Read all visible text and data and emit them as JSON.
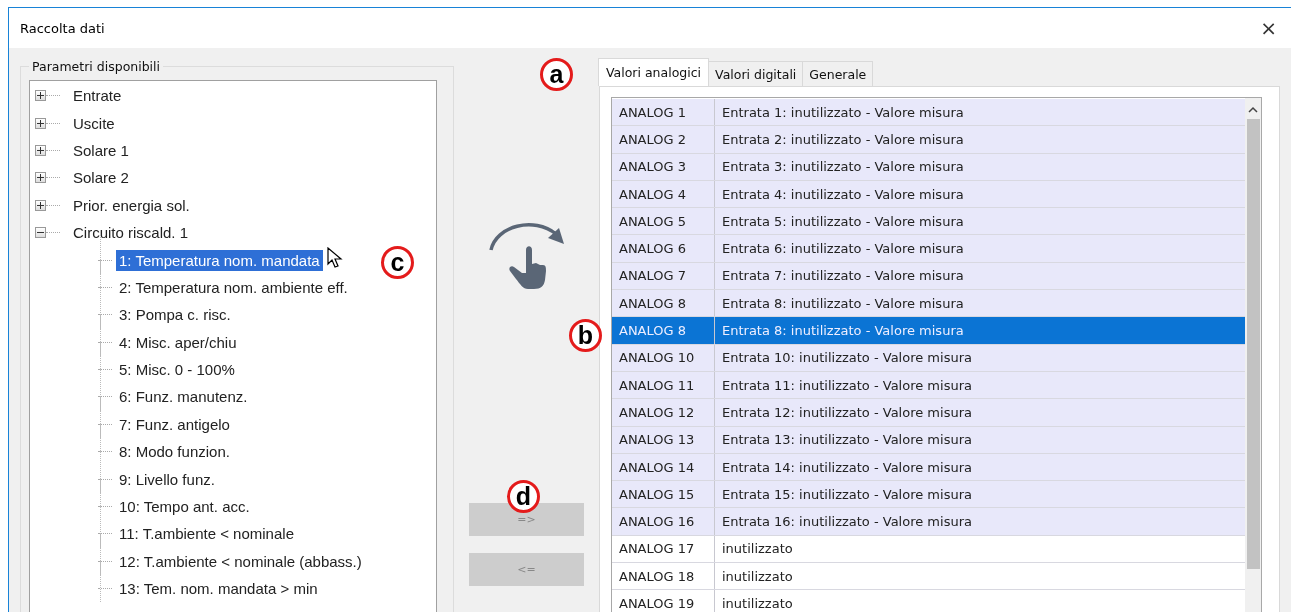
{
  "window": {
    "title": "Raccolta dati",
    "close": "×"
  },
  "parameters": {
    "title": "Parametri disponibili",
    "tree": [
      {
        "label": "Entrate",
        "expanded": false
      },
      {
        "label": "Uscite",
        "expanded": false
      },
      {
        "label": "Solare 1",
        "expanded": false
      },
      {
        "label": "Solare 2",
        "expanded": false
      },
      {
        "label": "Prior. energia sol.",
        "expanded": false
      },
      {
        "label": "Circuito riscald. 1",
        "expanded": true,
        "children": [
          {
            "label": "1: Temperatura nom. mandata",
            "selected": true
          },
          {
            "label": "2: Temperatura nom. ambiente eff.",
            "selected": false
          },
          {
            "label": "3: Pompa c. risc.",
            "selected": false
          },
          {
            "label": "4: Misc. aper/chiu",
            "selected": false
          },
          {
            "label": "5: Misc. 0 - 100%",
            "selected": false
          },
          {
            "label": "6: Funz. manutenz.",
            "selected": false
          },
          {
            "label": "7: Funz. antigelo",
            "selected": false
          },
          {
            "label": "8: Modo funzion.",
            "selected": false
          },
          {
            "label": "9: Livello funz.",
            "selected": false
          },
          {
            "label": "10: Tempo ant. acc.",
            "selected": false
          },
          {
            "label": "11: T.ambiente < nominale",
            "selected": false
          },
          {
            "label": "12: T.ambiente < nominale (abbass.)",
            "selected": false
          },
          {
            "label": "13: Tem. nom. mandata > min",
            "selected": false
          }
        ]
      }
    ]
  },
  "buttons": [
    {
      "label": "=>",
      "disabled": true
    },
    {
      "label": "<=",
      "disabled": true
    }
  ],
  "tabs": [
    {
      "label": "Valori analogici",
      "selected": true
    },
    {
      "label": "Valori digitali",
      "selected": false
    },
    {
      "label": "Generale",
      "selected": false
    }
  ],
  "table": {
    "rows": [
      {
        "channel": "ANALOG 1",
        "value": "Entrata 1: inutilizzato - Valore misura",
        "assigned": true,
        "selected": false
      },
      {
        "channel": "ANALOG 2",
        "value": "Entrata 2: inutilizzato - Valore misura",
        "assigned": true,
        "selected": false
      },
      {
        "channel": "ANALOG 3",
        "value": "Entrata 3: inutilizzato - Valore misura",
        "assigned": true,
        "selected": false
      },
      {
        "channel": "ANALOG 4",
        "value": "Entrata 4: inutilizzato - Valore misura",
        "assigned": true,
        "selected": false
      },
      {
        "channel": "ANALOG 5",
        "value": "Entrata 5: inutilizzato - Valore misura",
        "assigned": true,
        "selected": false
      },
      {
        "channel": "ANALOG 6",
        "value": "Entrata 6: inutilizzato - Valore misura",
        "assigned": true,
        "selected": false
      },
      {
        "channel": "ANALOG 7",
        "value": "Entrata 7: inutilizzato - Valore misura",
        "assigned": true,
        "selected": false
      },
      {
        "channel": "ANALOG 8",
        "value": "Entrata 8: inutilizzato - Valore misura",
        "assigned": true,
        "selected": false
      },
      {
        "channel": "ANALOG 8",
        "value": "Entrata 8: inutilizzato - Valore misura",
        "assigned": true,
        "selected": true
      },
      {
        "channel": "ANALOG 10",
        "value": "Entrata 10: inutilizzato - Valore misura",
        "assigned": true,
        "selected": false
      },
      {
        "channel": "ANALOG 11",
        "value": "Entrata 11: inutilizzato - Valore misura",
        "assigned": true,
        "selected": false
      },
      {
        "channel": "ANALOG 12",
        "value": "Entrata 12: inutilizzato - Valore misura",
        "assigned": true,
        "selected": false
      },
      {
        "channel": "ANALOG 13",
        "value": "Entrata 13: inutilizzato - Valore misura",
        "assigned": true,
        "selected": false
      },
      {
        "channel": "ANALOG 14",
        "value": "Entrata 14: inutilizzato - Valore misura",
        "assigned": true,
        "selected": false
      },
      {
        "channel": "ANALOG 15",
        "value": "Entrata 15: inutilizzato - Valore misura",
        "assigned": true,
        "selected": false
      },
      {
        "channel": "ANALOG 16",
        "value": "Entrata 16: inutilizzato - Valore misura",
        "assigned": true,
        "selected": false
      },
      {
        "channel": "ANALOG 17",
        "value": "inutilizzato",
        "assigned": false,
        "selected": false
      },
      {
        "channel": "ANALOG 18",
        "value": "inutilizzato",
        "assigned": false,
        "selected": false
      },
      {
        "channel": "ANALOG 19",
        "value": "inutilizzato",
        "assigned": false,
        "selected": false
      }
    ]
  },
  "annotations": [
    {
      "label": "a"
    },
    {
      "label": "b"
    },
    {
      "label": "c"
    },
    {
      "label": "d"
    }
  ]
}
